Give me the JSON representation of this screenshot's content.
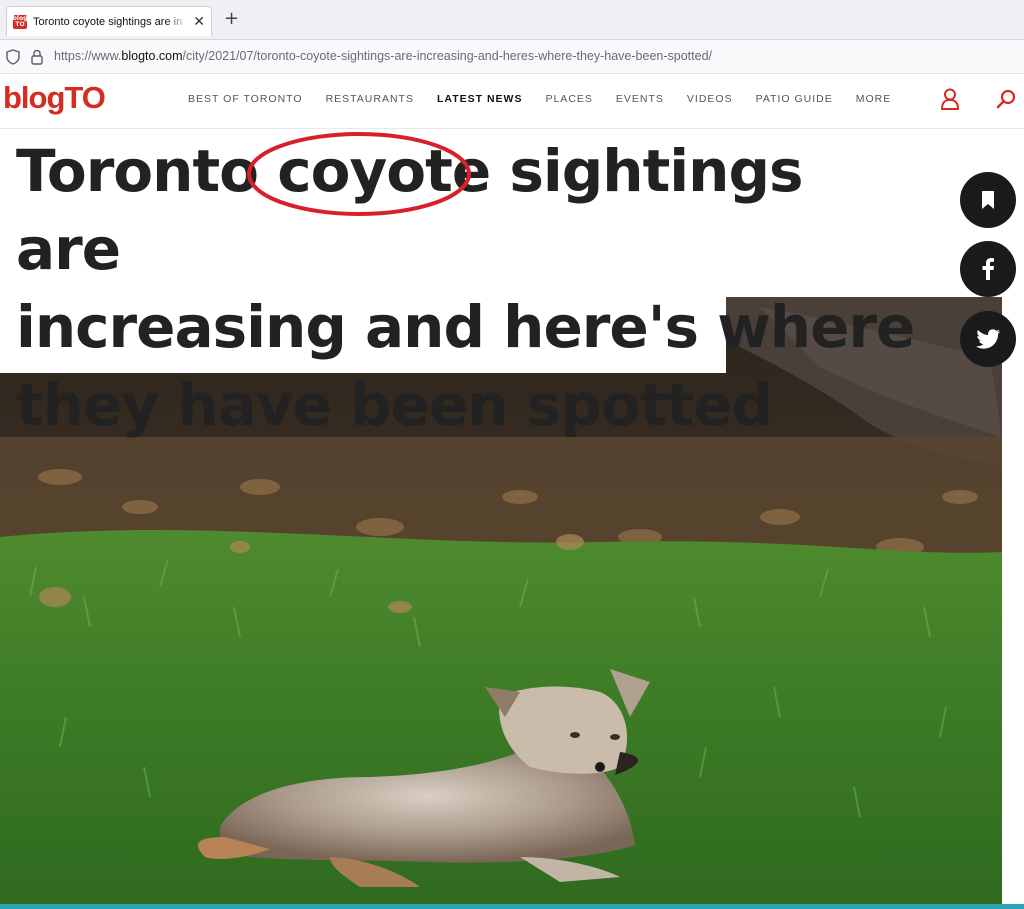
{
  "browser": {
    "tab_title": "Toronto coyote sightings are in",
    "tab_close": "✕",
    "new_tab": "+",
    "favicon_text": "blog TO",
    "url_prefix": "https://www.",
    "url_host": "blogto.com",
    "url_path": "/city/2021/07/toronto-coyote-sightings-are-increasing-and-heres-where-they-have-been-spotted/"
  },
  "site": {
    "logo": "blogTO",
    "nav": [
      "BEST OF TORONTO",
      "RESTAURANTS",
      "LATEST NEWS",
      "PLACES",
      "EVENTS",
      "VIDEOS",
      "PATIO GUIDE",
      "MORE"
    ],
    "active_nav": "LATEST NEWS",
    "accent_color": "#d62b1f"
  },
  "article": {
    "headline_line1_a": "Toronto ",
    "headline_line1_highlight": "coyote",
    "headline_line1_b": " sightings are",
    "headline_line2": "increasing and here's where",
    "headline_line3": "they have been spotted"
  },
  "social": {
    "icons": [
      "bookmark-icon",
      "facebook-icon",
      "twitter-icon"
    ]
  }
}
